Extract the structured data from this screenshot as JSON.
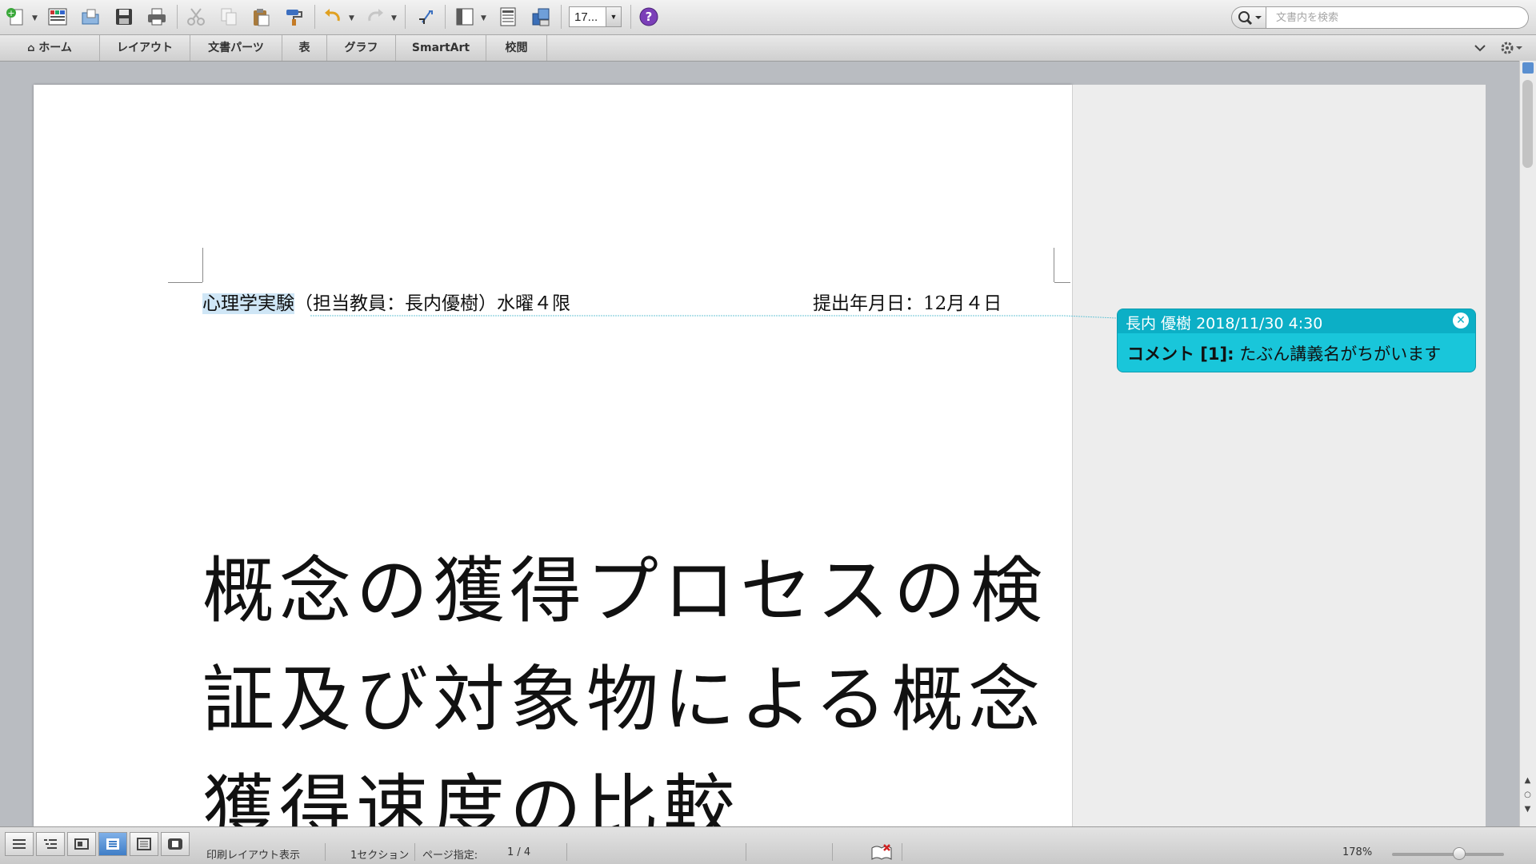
{
  "toolbar": {
    "zoom_value": "17...",
    "search_placeholder": "文書内を検索"
  },
  "ribbon": {
    "tabs": [
      "ホーム",
      "レイアウト",
      "文書パーツ",
      "表",
      "グラフ",
      "SmartArt",
      "校閲"
    ]
  },
  "document": {
    "header_selected": "心理学実験",
    "header_rest": "（担当教員：長内優樹）水曜４限",
    "submit_date": "提出年月日：12月４日",
    "title_lines": [
      "概念の獲得プロセスの検",
      "証及び対象物による概念",
      "獲得速度の比較"
    ]
  },
  "comment": {
    "author_time": "長内 優樹 2018/11/30 4:30",
    "label": "コメント [1]:",
    "text": " たぶん講義名がちがいます"
  },
  "status": {
    "view_name": "印刷レイアウト表示",
    "section": "1セクション",
    "page_label": "ページ指定:",
    "page_value": "1 / 4",
    "zoom": "178%"
  },
  "colors": {
    "comment_bg": "#19c6da",
    "comment_head": "#0cafc6",
    "selection": "#cfe6f6"
  }
}
